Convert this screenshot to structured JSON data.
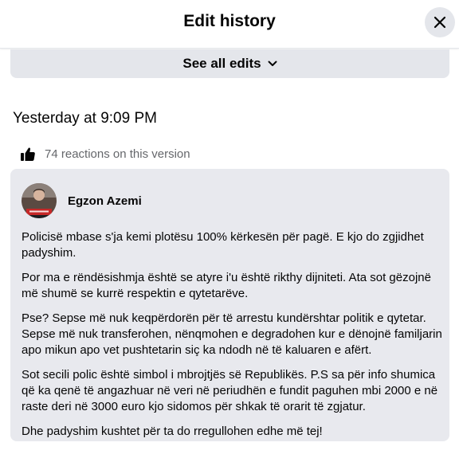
{
  "header": {
    "title": "Edit history",
    "close_icon": "close-icon"
  },
  "see_all": {
    "label": "See all edits",
    "icon": "chevron-down-icon"
  },
  "version": {
    "timestamp": "Yesterday at 9:09 PM",
    "reactions_text": "74 reactions on this version",
    "reactions_icon": "thumbs-up-icon"
  },
  "post": {
    "author": "Egzon Azemi",
    "paragraphs": [
      "Policisë mbase s'ja kemi plotësu 100% kërkesën për pagë. E kjo do zgjidhet padyshim.",
      "Por ma e rëndësishmja është se atyre i'u është rikthy dijniteti. Ata sot gëzojnë më shumë se kurrë respektin e qytetarëve.",
      "Pse? Sepse më nuk keqpërdorën për të arrestu kundërshtar politik e qytetar. Sepse më nuk transferohen, nënqmohen e degradohen kur e dënojnë familjarin apo mikun apo vet pushtetarin siç ka ndodh në të kaluaren e afërt.",
      "Sot secili polic është simbol i mbrojtjës së Republikës. P.S sa për info shumica që ka qenë të angazhuar në veri në periudhën e fundit paguhen mbi 2000 e në raste deri në 3000 euro kjo sidomos për shkak të orarit të zgjatur.",
      "Dhe padyshim kushtet për ta do rregullohen edhe më tej!"
    ]
  },
  "colors": {
    "card_bg": "#e8e9ee",
    "button_bg": "#e4e6eb",
    "secondary_text": "#65676b",
    "avatar_accent": "#c62828"
  }
}
